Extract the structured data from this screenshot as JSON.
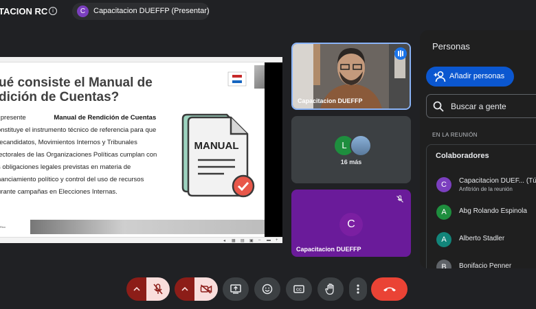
{
  "topbar": {
    "meeting_title": "TACION RC",
    "presenter_initial": "C",
    "presenting_label": "Capacitacion DUEFFP (Presentar)"
  },
  "slide": {
    "title_line1": "ué consiste el Manual de",
    "title_line2": "dición de Cuentas?",
    "body_prefix": "l presente",
    "body_bold": "Manual de Rendición de Cuentas",
    "body_lines": [
      "onstituye el instrumento técnico de referencia para que",
      "recandidatos, Movimientos Internos y Tribunales",
      "lectorales de las Organizaciones Políticas cumplan con",
      "s obligaciones legales previstas en materia de",
      "nanciamiento político y control del uso de recursos",
      "urante campañas en Elecciones Internas."
    ],
    "doc_label": "MANUAL",
    "footer_text": "Rico"
  },
  "tiles": {
    "main_name": "Capacitacion DUEFFP",
    "others_initial": "L",
    "others_count": "16 más",
    "self_initial": "C",
    "self_name": "Capacitacion DUEFFP"
  },
  "panel": {
    "title": "Personas",
    "add_people": "Añadir personas",
    "search_placeholder": "Buscar a gente",
    "section": "EN LA REUNIÓN",
    "group_title": "Colaboradores",
    "people": [
      {
        "initial": "C",
        "name": "Capacitacion DUEF...  (Tú)",
        "subtitle": "Anfitrión de la reunión",
        "color": "#7b3fbf"
      },
      {
        "initial": "A",
        "name": "Abg Rolando Espinola",
        "subtitle": "",
        "color": "#1e8e3e"
      },
      {
        "initial": "A",
        "name": "Alberto Stadler",
        "subtitle": "",
        "color": "#12857a"
      },
      {
        "initial": "B",
        "name": "Bonifacio Penner",
        "subtitle": "",
        "color": "#5f6368"
      }
    ]
  },
  "colors": {
    "accent": "#8ab4f8",
    "primary_button": "#0b57d0",
    "end_call": "#ea4335",
    "muted_red": "#8c1d18",
    "muted_pink": "#f9dedc"
  }
}
